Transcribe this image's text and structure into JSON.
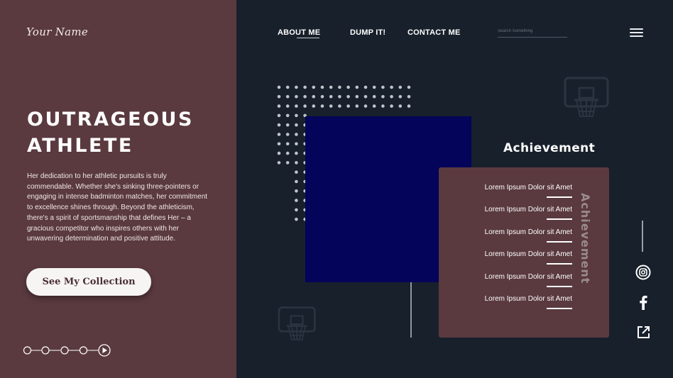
{
  "brand": {
    "logo_text": "Your Name"
  },
  "nav": {
    "items": [
      {
        "label": "ABOUT ME",
        "active": true
      },
      {
        "label": "DUMP IT!"
      },
      {
        "label": "CONTACT ME"
      }
    ],
    "search_placeholder": "Search Something",
    "menu_icon": "hamburger-menu-icon"
  },
  "hero": {
    "title_line1": "OUTRAGEOUS",
    "title_line2": "ATHLETE",
    "description": "Her dedication to her athletic pursuits is truly commendable. Whether she's sinking three-pointers or engaging in intense badminton matches, her commitment to excellence shines through. Beyond the athleticism, there's a spirit of sportsmanship that defines Her – a gracious competitor who inspires others with her unwavering determination and positive attitude.",
    "cta_label": "See My Collection"
  },
  "pager": {
    "count": 5,
    "play_icon": "play-icon"
  },
  "achievement": {
    "title": "Achievement",
    "vertical_label": "Achievement",
    "items": [
      "Lorem Ipsum Dolor sit Amet",
      "Lorem Ipsum Dolor sit Amet",
      "Lorem Ipsum Dolor sit Amet",
      "Lorem Ipsum Dolor sit Amet",
      "Lorem Ipsum Dolor sit Amet",
      "Lorem Ipsum Dolor sit Amet"
    ]
  },
  "social": [
    "instagram-icon",
    "facebook-icon",
    "external-link-icon"
  ],
  "colors": {
    "left_panel": "#5a3a3f",
    "background": "#18202b",
    "navy_block": "#04045a",
    "card": "#5a3a3f"
  }
}
